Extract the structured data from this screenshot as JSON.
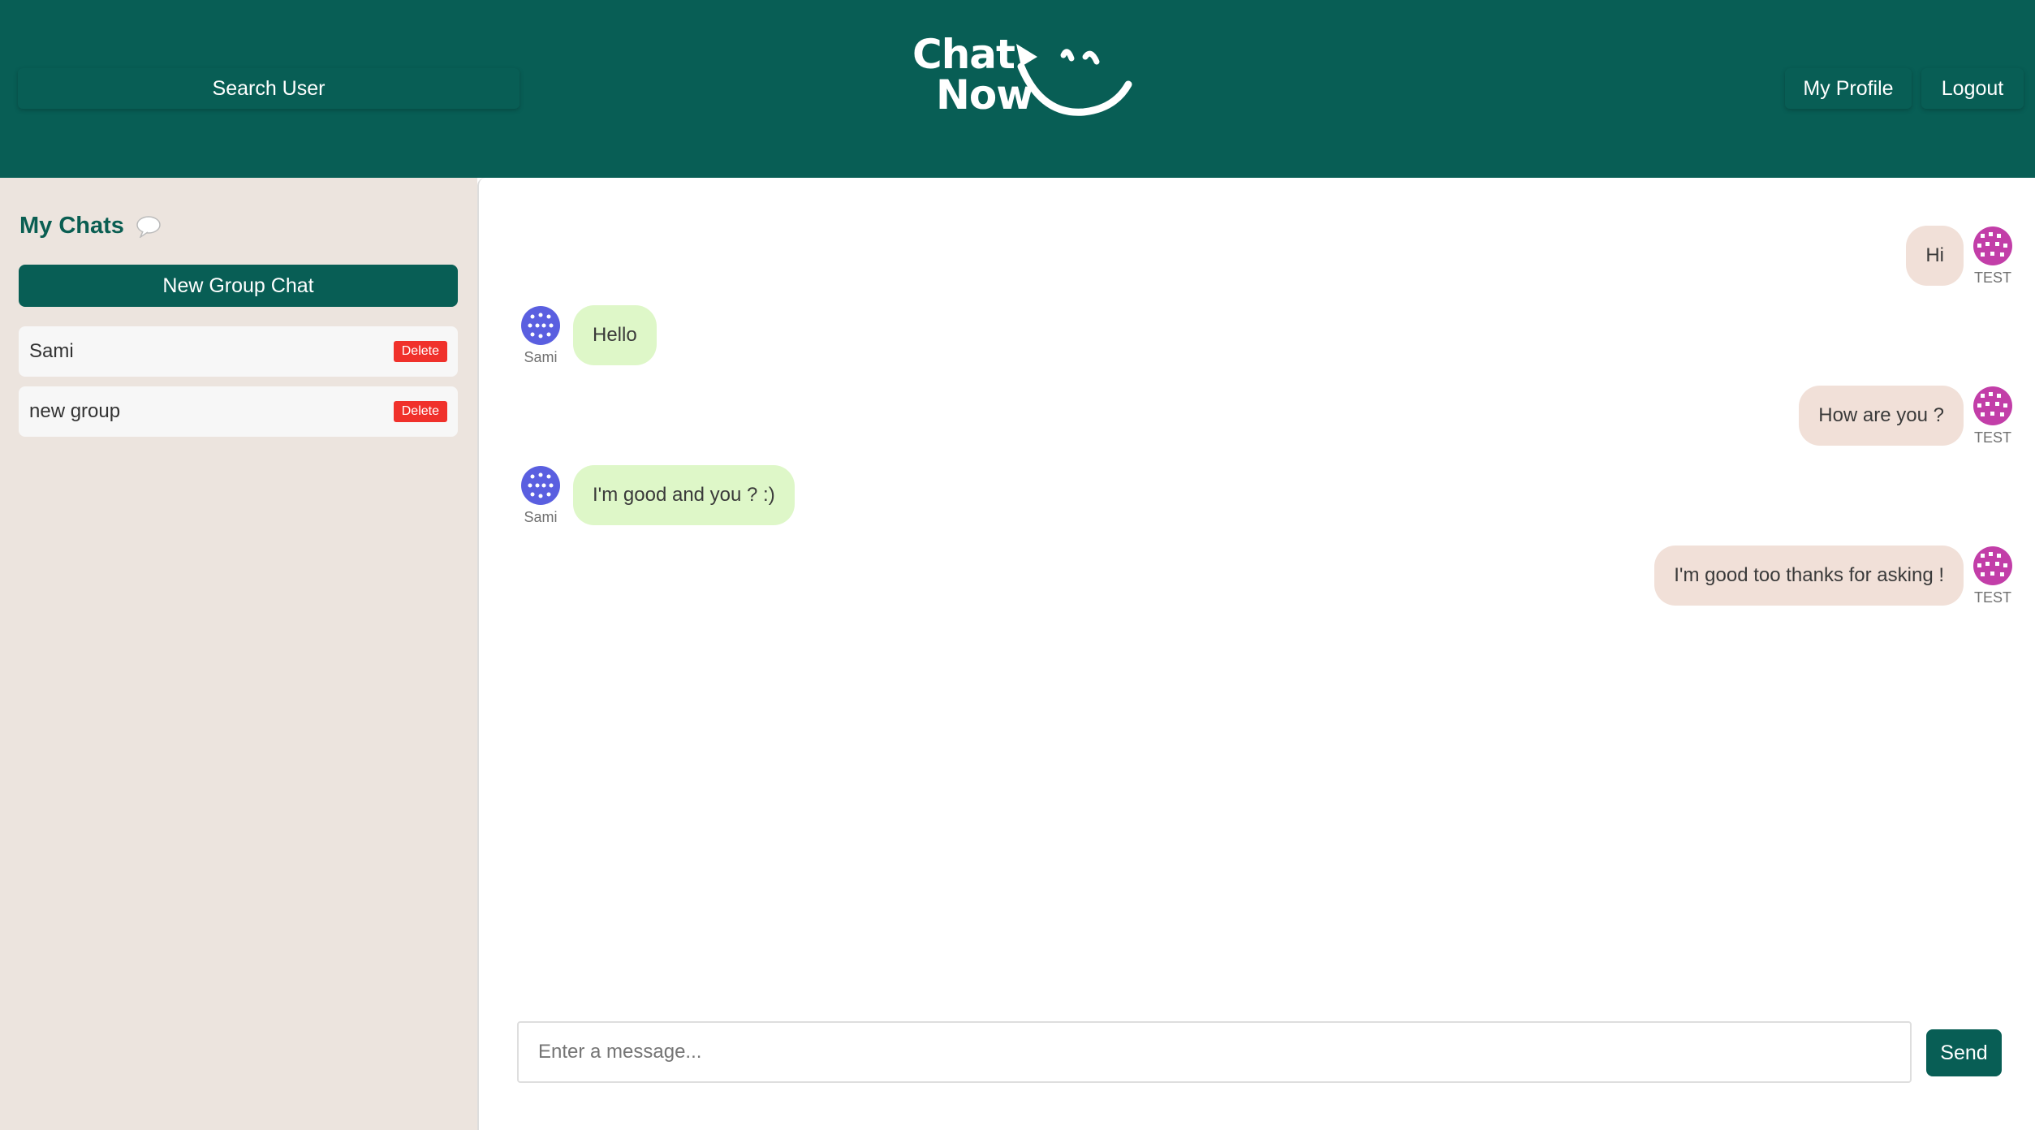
{
  "header": {
    "search_label": "Search User",
    "logo_line1": "Chat",
    "logo_line2": "Now",
    "profile_label": "My Profile",
    "logout_label": "Logout",
    "bg_color": "#085e55"
  },
  "sidebar": {
    "title": "My Chats",
    "new_group_label": "New Group Chat",
    "chats": [
      {
        "name": "Sami",
        "delete_label": "Delete"
      },
      {
        "name": "new group",
        "delete_label": "Delete"
      }
    ]
  },
  "messages": [
    {
      "text": "Hi",
      "sender": "TEST",
      "mine": true
    },
    {
      "text": "Hello",
      "sender": "Sami",
      "mine": false
    },
    {
      "text": "How are you ?",
      "sender": "TEST",
      "mine": true
    },
    {
      "text": "I'm good and you ? :)",
      "sender": "Sami",
      "mine": false
    },
    {
      "text": "I'm good too thanks for asking !",
      "sender": "TEST",
      "mine": true
    }
  ],
  "composer": {
    "placeholder": "Enter a message...",
    "send_label": "Send"
  },
  "colors": {
    "accent": "#085e55",
    "sidebar_bg": "#ece4de",
    "mine_bubble": "#f1e0d8",
    "theirs_bubble": "#def7c8",
    "delete": "#f0312b",
    "avatar_test": "#c23ea8",
    "avatar_sami": "#5a5fe0"
  }
}
